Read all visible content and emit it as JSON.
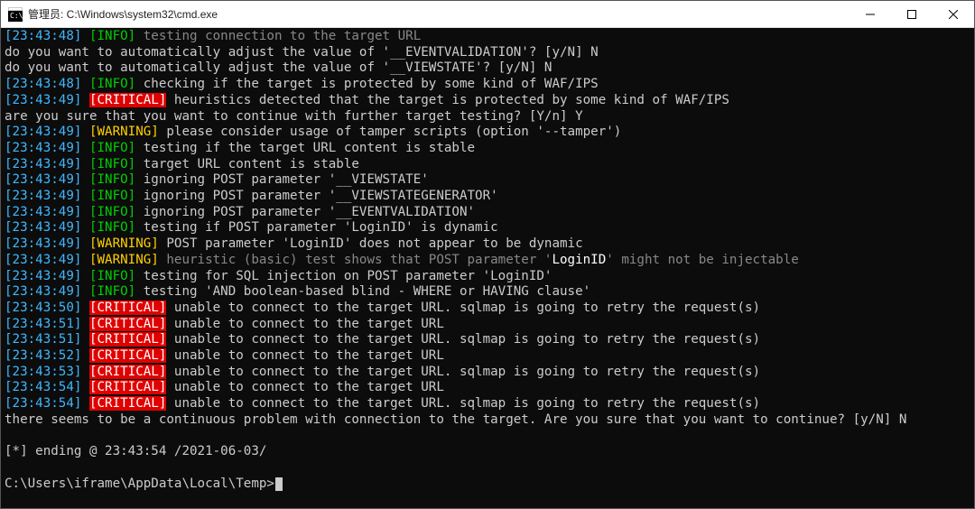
{
  "window": {
    "title": "管理员: C:\\Windows\\system32\\cmd.exe"
  },
  "lines": [
    {
      "type": "tagged",
      "ts": "[23:43:48]",
      "tag": "[INFO]",
      "tagClass": "infotag",
      "msg": " testing connection to the target URL",
      "msgClass": "dim"
    },
    {
      "type": "plain",
      "text": "do you want to automatically adjust the value of '__EVENTVALIDATION'? [y/N] N",
      "cls": "msg"
    },
    {
      "type": "plain",
      "text": "do you want to automatically adjust the value of '__VIEWSTATE'? [y/N] N",
      "cls": "msg"
    },
    {
      "type": "tagged",
      "ts": "[23:43:48]",
      "tag": "[INFO]",
      "tagClass": "infotag",
      "msg": " checking if the target is protected by some kind of WAF/IPS",
      "msgClass": "msg"
    },
    {
      "type": "tagged",
      "ts": "[23:43:49]",
      "tag": "[CRITICAL]",
      "tagClass": "crittag",
      "msg": " heuristics detected that the target is protected by some kind of WAF/IPS",
      "msgClass": "msg"
    },
    {
      "type": "plain",
      "text": "are you sure that you want to continue with further target testing? [Y/n] Y",
      "cls": "msg"
    },
    {
      "type": "tagged",
      "ts": "[23:43:49]",
      "tag": "[WARNING]",
      "tagClass": "warntag",
      "msg": " please consider usage of tamper scripts (option '--tamper')",
      "msgClass": "msg"
    },
    {
      "type": "tagged",
      "ts": "[23:43:49]",
      "tag": "[INFO]",
      "tagClass": "infotag",
      "msg": " testing if the target URL content is stable",
      "msgClass": "msg"
    },
    {
      "type": "tagged",
      "ts": "[23:43:49]",
      "tag": "[INFO]",
      "tagClass": "infotag",
      "msg": " target URL content is stable",
      "msgClass": "msg"
    },
    {
      "type": "tagged",
      "ts": "[23:43:49]",
      "tag": "[INFO]",
      "tagClass": "infotag",
      "msg": " ignoring POST parameter '__VIEWSTATE'",
      "msgClass": "msg"
    },
    {
      "type": "tagged",
      "ts": "[23:43:49]",
      "tag": "[INFO]",
      "tagClass": "infotag",
      "msg": " ignoring POST parameter '__VIEWSTATEGENERATOR'",
      "msgClass": "msg"
    },
    {
      "type": "tagged",
      "ts": "[23:43:49]",
      "tag": "[INFO]",
      "tagClass": "infotag",
      "msg": " ignoring POST parameter '__EVENTVALIDATION'",
      "msgClass": "msg"
    },
    {
      "type": "tagged",
      "ts": "[23:43:49]",
      "tag": "[INFO]",
      "tagClass": "infotag",
      "msg": " testing if POST parameter 'LoginID' is dynamic",
      "msgClass": "msg"
    },
    {
      "type": "tagged",
      "ts": "[23:43:49]",
      "tag": "[WARNING]",
      "tagClass": "warntag",
      "msg": " POST parameter 'LoginID' does not appear to be dynamic",
      "msgClass": "msg"
    },
    {
      "type": "mixed",
      "ts": "[23:43:49]",
      "tag": "[WARNING]",
      "tagClass": "warntag",
      "parts": [
        {
          "text": " heuristic (basic) test shows that POST parameter '",
          "cls": "dim"
        },
        {
          "text": "LoginID",
          "cls": "bright"
        },
        {
          "text": "' might not be injectable",
          "cls": "dim"
        }
      ]
    },
    {
      "type": "tagged",
      "ts": "[23:43:49]",
      "tag": "[INFO]",
      "tagClass": "infotag",
      "msg": " testing for SQL injection on POST parameter 'LoginID'",
      "msgClass": "msg"
    },
    {
      "type": "tagged",
      "ts": "[23:43:49]",
      "tag": "[INFO]",
      "tagClass": "infotag",
      "msg": " testing 'AND boolean-based blind - WHERE or HAVING clause'",
      "msgClass": "msg"
    },
    {
      "type": "tagged",
      "ts": "[23:43:50]",
      "tag": "[CRITICAL]",
      "tagClass": "crittag",
      "msg": " unable to connect to the target URL. sqlmap is going to retry the request(s)",
      "msgClass": "msg"
    },
    {
      "type": "tagged",
      "ts": "[23:43:51]",
      "tag": "[CRITICAL]",
      "tagClass": "crittag",
      "msg": " unable to connect to the target URL",
      "msgClass": "msg"
    },
    {
      "type": "tagged",
      "ts": "[23:43:51]",
      "tag": "[CRITICAL]",
      "tagClass": "crittag",
      "msg": " unable to connect to the target URL. sqlmap is going to retry the request(s)",
      "msgClass": "msg"
    },
    {
      "type": "tagged",
      "ts": "[23:43:52]",
      "tag": "[CRITICAL]",
      "tagClass": "crittag",
      "msg": " unable to connect to the target URL",
      "msgClass": "msg"
    },
    {
      "type": "tagged",
      "ts": "[23:43:53]",
      "tag": "[CRITICAL]",
      "tagClass": "crittag",
      "msg": " unable to connect to the target URL. sqlmap is going to retry the request(s)",
      "msgClass": "msg"
    },
    {
      "type": "tagged",
      "ts": "[23:43:54]",
      "tag": "[CRITICAL]",
      "tagClass": "crittag",
      "msg": " unable to connect to the target URL",
      "msgClass": "msg"
    },
    {
      "type": "tagged",
      "ts": "[23:43:54]",
      "tag": "[CRITICAL]",
      "tagClass": "crittag",
      "msg": " unable to connect to the target URL. sqlmap is going to retry the request(s)",
      "msgClass": "msg"
    },
    {
      "type": "plain",
      "text": "there seems to be a continuous problem with connection to the target. Are you sure that you want to continue? [y/N] N",
      "cls": "msg"
    },
    {
      "type": "blank"
    },
    {
      "type": "plain",
      "text": "[*] ending @ 23:43:54 /2021-06-03/",
      "cls": "msg"
    },
    {
      "type": "blank"
    }
  ],
  "prompt": "C:\\Users\\iframe\\AppData\\Local\\Temp>"
}
